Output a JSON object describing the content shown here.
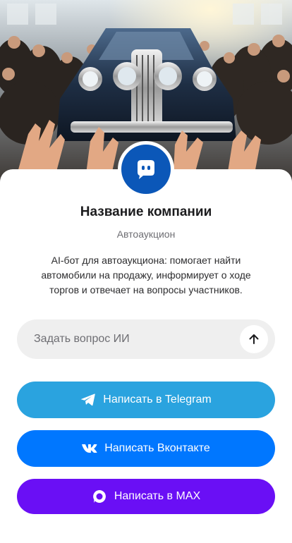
{
  "company": {
    "name": "Название компании",
    "category": "Автоаукцион",
    "description": "AI-бот для автоаукциона: помогает найти автомобили на продажу, информирует о ходе торгов и отвечает на вопросы участников."
  },
  "ask": {
    "placeholder": "Задать вопрос ИИ",
    "icon": "arrow-up-icon"
  },
  "buttons": [
    {
      "label": "Написать в Telegram",
      "icon": "telegram-icon",
      "color": "#2aa3df"
    },
    {
      "label": "Написать Вконтакте",
      "icon": "vk-icon",
      "color": "#0077ff"
    },
    {
      "label": "Написать в MAX",
      "icon": "max-icon",
      "color": "#6a0ff5"
    }
  ],
  "avatar": {
    "icon": "chat-bot-icon",
    "color": "#0b57b8"
  }
}
